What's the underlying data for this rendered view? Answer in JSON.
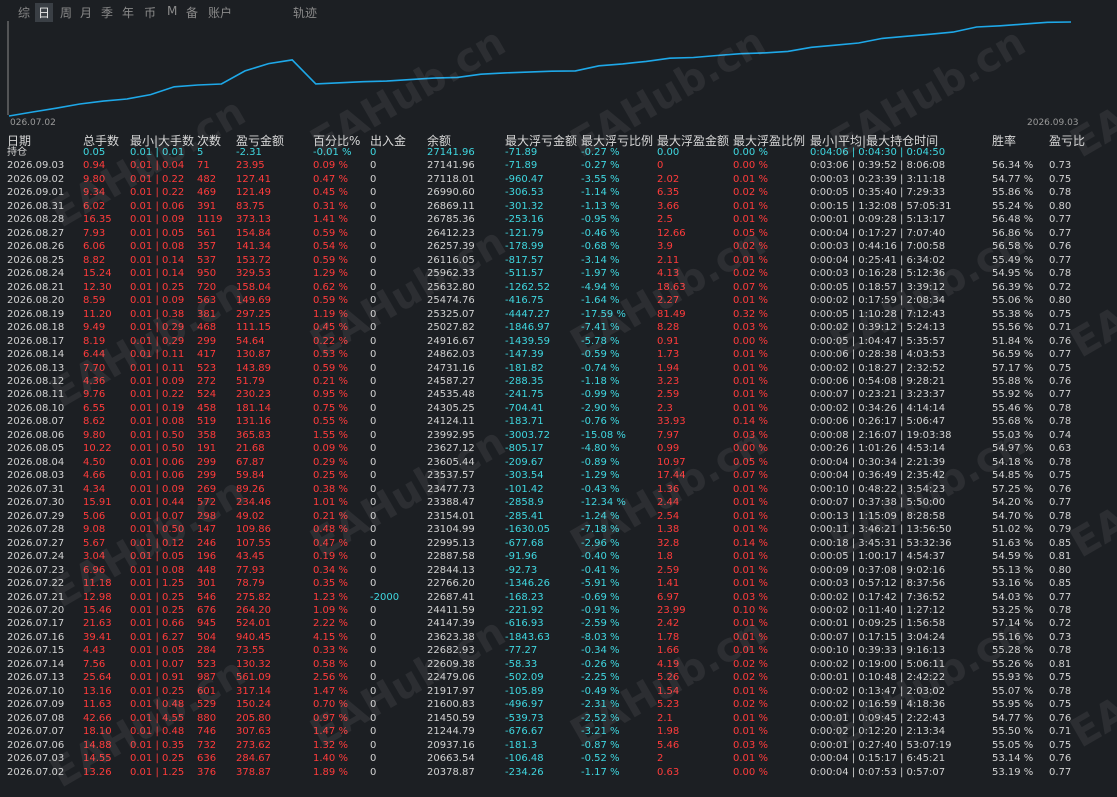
{
  "tabs": [
    "综",
    "日",
    "周",
    "月",
    "季",
    "年",
    "币",
    "M",
    "备",
    "账户",
    "轨迹"
  ],
  "active_tab": 1,
  "chart_data": {
    "type": "line",
    "x_start_label": "026.07.02",
    "x_end_label": "2026.09.03",
    "line_color": "#1ea8e8",
    "y": [
      20378.87,
      20663.54,
      20937.16,
      21244.79,
      21450.59,
      21600.83,
      21917.97,
      22479.06,
      22609.38,
      22682.93,
      23623.38,
      24147.39,
      24411.59,
      22687.41,
      22766.2,
      22844.13,
      22887.58,
      22995.13,
      23104.99,
      23154.01,
      23388.47,
      23477.73,
      23537.57,
      23605.44,
      23627.12,
      23992.95,
      24124.11,
      24305.25,
      24535.48,
      24587.27,
      24731.16,
      24862.03,
      24916.67,
      25027.82,
      25325.07,
      25474.76,
      25632.8,
      25962.33,
      26116.05,
      26257.39,
      26412.23,
      26785.36,
      26869.11,
      26990.6,
      27118.01,
      27141.96
    ]
  },
  "columns": [
    "日期",
    "总手数",
    "最小|大手数",
    "次数",
    "盈亏金额",
    "百分比%",
    "出入金",
    "余额",
    "最大浮亏金额",
    "最大浮亏比例",
    "最大浮盈金额",
    "最大浮盈比例",
    "最小|平均|最大持仓时间",
    "胜率",
    "盈亏比"
  ],
  "holding_row": [
    "持仓",
    "0.05",
    "0.01 | 0.01",
    "5",
    "-2.31",
    "-0.01 %",
    "0",
    "27141.96",
    "-71.89",
    "-0.27 %",
    "0.00",
    "0.00 %",
    "0:04:06 | 0:04:30 | 0:04:50",
    "",
    ""
  ],
  "rows": [
    [
      "2026.09.03",
      "0.94",
      "0.01 | 0.04",
      "71",
      "23.95",
      "0.09 %",
      "0",
      "27141.96",
      "-71.89",
      "-0.27 %",
      "0",
      "0.00 %",
      "0:03:06 | 0:39:52 | 8:06:08",
      "56.34 %",
      "0.73"
    ],
    [
      "2026.09.02",
      "9.80",
      "0.01 | 0.22",
      "482",
      "127.41",
      "0.47 %",
      "0",
      "27118.01",
      "-960.47",
      "-3.55 %",
      "2.02",
      "0.01 %",
      "0:00:03 | 0:23:39 | 3:11:18",
      "54.77 %",
      "0.75"
    ],
    [
      "2026.09.01",
      "9.34",
      "0.01 | 0.22",
      "469",
      "121.49",
      "0.45 %",
      "0",
      "26990.60",
      "-306.53",
      "-1.14 %",
      "6.35",
      "0.02 %",
      "0:00:05 | 0:35:40 | 7:29:33",
      "55.86 %",
      "0.78"
    ],
    [
      "2026.08.31",
      "6.02",
      "0.01 | 0.06",
      "391",
      "83.75",
      "0.31 %",
      "0",
      "26869.11",
      "-301.32",
      "-1.13 %",
      "3.66",
      "0.01 %",
      "0:00:15 | 1:32:08 | 57:05:31",
      "55.24 %",
      "0.80"
    ],
    [
      "2026.08.28",
      "16.35",
      "0.01 | 0.09",
      "1119",
      "373.13",
      "1.41 %",
      "0",
      "26785.36",
      "-253.16",
      "-0.95 %",
      "2.5",
      "0.01 %",
      "0:00:01 | 0:09:28 | 5:13:17",
      "56.48 %",
      "0.77"
    ],
    [
      "2026.08.27",
      "7.93",
      "0.01 | 0.05",
      "561",
      "154.84",
      "0.59 %",
      "0",
      "26412.23",
      "-121.79",
      "-0.46 %",
      "12.66",
      "0.05 %",
      "0:00:04 | 0:17:27 | 7:07:40",
      "56.86 %",
      "0.77"
    ],
    [
      "2026.08.26",
      "6.06",
      "0.01 | 0.08",
      "357",
      "141.34",
      "0.54 %",
      "0",
      "26257.39",
      "-178.99",
      "-0.68 %",
      "3.9",
      "0.02 %",
      "0:00:03 | 0:44:16 | 7:00:58",
      "56.58 %",
      "0.76"
    ],
    [
      "2026.08.25",
      "8.82",
      "0.01 | 0.14",
      "537",
      "153.72",
      "0.59 %",
      "0",
      "26116.05",
      "-817.57",
      "-3.14 %",
      "2.11",
      "0.01 %",
      "0:00:04 | 0:25:41 | 6:34:02",
      "55.49 %",
      "0.77"
    ],
    [
      "2026.08.24",
      "15.24",
      "0.01 | 0.14",
      "950",
      "329.53",
      "1.29 %",
      "0",
      "25962.33",
      "-511.57",
      "-1.97 %",
      "4.13",
      "0.02 %",
      "0:00:03 | 0:16:28 | 5:12:36",
      "54.95 %",
      "0.78"
    ],
    [
      "2026.08.21",
      "12.30",
      "0.01 | 0.25",
      "720",
      "158.04",
      "0.62 %",
      "0",
      "25632.80",
      "-1262.52",
      "-4.94 %",
      "18.63",
      "0.07 %",
      "0:00:05 | 0:18:57 | 3:39:12",
      "56.39 %",
      "0.72"
    ],
    [
      "2026.08.20",
      "8.59",
      "0.01 | 0.09",
      "563",
      "149.69",
      "0.59 %",
      "0",
      "25474.76",
      "-416.75",
      "-1.64 %",
      "2.27",
      "0.01 %",
      "0:00:02 | 0:17:59 | 2:08:34",
      "55.06 %",
      "0.80"
    ],
    [
      "2026.08.19",
      "11.20",
      "0.01 | 0.38",
      "381",
      "297.25",
      "1.19 %",
      "0",
      "25325.07",
      "-4447.27",
      "-17.59 %",
      "81.49",
      "0.32 %",
      "0:00:05 | 1:10:28 | 7:12:43",
      "55.38 %",
      "0.75"
    ],
    [
      "2026.08.18",
      "9.49",
      "0.01 | 0.29",
      "468",
      "111.15",
      "0.45 %",
      "0",
      "25027.82",
      "-1846.97",
      "-7.41 %",
      "8.28",
      "0.03 %",
      "0:00:02 | 0:39:12 | 5:24:13",
      "55.56 %",
      "0.71"
    ],
    [
      "2026.08.17",
      "8.19",
      "0.01 | 0.29",
      "299",
      "54.64",
      "0.22 %",
      "0",
      "24916.67",
      "-1439.59",
      "-5.78 %",
      "0.91",
      "0.00 %",
      "0:00:05 | 1:04:47 | 5:35:57",
      "51.84 %",
      "0.76"
    ],
    [
      "2026.08.14",
      "6.44",
      "0.01 | 0.11",
      "417",
      "130.87",
      "0.53 %",
      "0",
      "24862.03",
      "-147.39",
      "-0.59 %",
      "1.73",
      "0.01 %",
      "0:00:06 | 0:28:38 | 4:03:53",
      "56.59 %",
      "0.77"
    ],
    [
      "2026.08.13",
      "7.70",
      "0.01 | 0.11",
      "523",
      "143.89",
      "0.59 %",
      "0",
      "24731.16",
      "-181.82",
      "-0.74 %",
      "1.94",
      "0.01 %",
      "0:00:02 | 0:18:27 | 2:32:52",
      "57.17 %",
      "0.75"
    ],
    [
      "2026.08.12",
      "4.36",
      "0.01 | 0.09",
      "272",
      "51.79",
      "0.21 %",
      "0",
      "24587.27",
      "-288.35",
      "-1.18 %",
      "3.23",
      "0.01 %",
      "0:00:06 | 0:54:08 | 9:28:21",
      "55.88 %",
      "0.76"
    ],
    [
      "2026.08.11",
      "9.76",
      "0.01 | 0.22",
      "524",
      "230.23",
      "0.95 %",
      "0",
      "24535.48",
      "-241.75",
      "-0.99 %",
      "2.59",
      "0.01 %",
      "0:00:07 | 0:23:21 | 3:23:37",
      "55.92 %",
      "0.77"
    ],
    [
      "2026.08.10",
      "6.55",
      "0.01 | 0.19",
      "458",
      "181.14",
      "0.75 %",
      "0",
      "24305.25",
      "-704.41",
      "-2.90 %",
      "2.3",
      "0.01 %",
      "0:00:02 | 0:34:26 | 4:14:14",
      "55.46 %",
      "0.78"
    ],
    [
      "2026.08.07",
      "8.62",
      "0.01 | 0.08",
      "519",
      "131.16",
      "0.55 %",
      "0",
      "24124.11",
      "-183.71",
      "-0.76 %",
      "33.93",
      "0.14 %",
      "0:00:06 | 0:26:17 | 5:06:47",
      "55.68 %",
      "0.78"
    ],
    [
      "2026.08.06",
      "9.80",
      "0.01 | 0.50",
      "358",
      "365.83",
      "1.55 %",
      "0",
      "23992.95",
      "-3003.72",
      "-15.08 %",
      "7.97",
      "0.03 %",
      "0:00:08 | 2:16:07 | 19:03:38",
      "55.03 %",
      "0.74"
    ],
    [
      "2026.08.05",
      "10.22",
      "0.01 | 0.50",
      "191",
      "21.68",
      "0.09 %",
      "0",
      "23627.12",
      "-805.17",
      "-4.80 %",
      "0.99",
      "0.00 %",
      "0:00:26 | 1:01:26 | 4:53:14",
      "54.97 %",
      "0.63"
    ],
    [
      "2026.08.04",
      "4.50",
      "0.01 | 0.06",
      "299",
      "67.87",
      "0.29 %",
      "0",
      "23605.44",
      "-209.67",
      "-0.89 %",
      "10.97",
      "0.05 %",
      "0:00:04 | 0:30:34 | 2:21:39",
      "54.18 %",
      "0.78"
    ],
    [
      "2026.08.03",
      "4.66",
      "0.01 | 0.06",
      "299",
      "59.84",
      "0.25 %",
      "0",
      "23537.57",
      "-303.54",
      "-1.29 %",
      "17.44",
      "0.07 %",
      "0:00:04 | 0:36:49 | 2:35:42",
      "54.85 %",
      "0.75"
    ],
    [
      "2026.07.31",
      "4.34",
      "0.01 | 0.09",
      "269",
      "89.26",
      "0.38 %",
      "0",
      "23477.73",
      "-101.42",
      "-0.43 %",
      "1.36",
      "0.01 %",
      "0:00:10 | 0:48:22 | 3:54:23",
      "57.25 %",
      "0.76"
    ],
    [
      "2026.07.30",
      "15.91",
      "0.01 | 0.44",
      "572",
      "234.46",
      "1.01 %",
      "0",
      "23388.47",
      "-2858.9",
      "-12.34 %",
      "2.44",
      "0.01 %",
      "0:00:07 | 0:37:38 | 5:50:00",
      "54.20 %",
      "0.77"
    ],
    [
      "2026.07.29",
      "5.06",
      "0.01 | 0.07",
      "298",
      "49.02",
      "0.21 %",
      "0",
      "23154.01",
      "-285.41",
      "-1.24 %",
      "2.54",
      "0.01 %",
      "0:00:13 | 1:15:09 | 8:28:58",
      "54.70 %",
      "0.78"
    ],
    [
      "2026.07.28",
      "9.08",
      "0.01 | 0.50",
      "147",
      "109.86",
      "0.48 %",
      "0",
      "23104.99",
      "-1630.05",
      "-7.18 %",
      "1.38",
      "0.01 %",
      "0:00:11 | 3:46:21 | 13:56:50",
      "51.02 %",
      "0.79"
    ],
    [
      "2026.07.27",
      "5.67",
      "0.01 | 0.12",
      "246",
      "107.55",
      "0.47 %",
      "0",
      "22995.13",
      "-677.68",
      "-2.96 %",
      "32.8",
      "0.14 %",
      "0:00:18 | 3:45:31 | 53:32:36",
      "51.63 %",
      "0.85"
    ],
    [
      "2026.07.24",
      "3.04",
      "0.01 | 0.05",
      "196",
      "43.45",
      "0.19 %",
      "0",
      "22887.58",
      "-91.96",
      "-0.40 %",
      "1.8",
      "0.01 %",
      "0:00:05 | 1:00:17 | 4:54:37",
      "54.59 %",
      "0.81"
    ],
    [
      "2026.07.23",
      "6.96",
      "0.01 | 0.08",
      "448",
      "77.93",
      "0.34 %",
      "0",
      "22844.13",
      "-92.73",
      "-0.41 %",
      "2.59",
      "0.01 %",
      "0:00:09 | 0:37:08 | 9:02:16",
      "55.13 %",
      "0.80"
    ],
    [
      "2026.07.22",
      "11.18",
      "0.01 | 1.25",
      "301",
      "78.79",
      "0.35 %",
      "0",
      "22766.20",
      "-1346.26",
      "-5.91 %",
      "1.41",
      "0.01 %",
      "0:00:03 | 0:57:12 | 8:37:56",
      "53.16 %",
      "0.85"
    ],
    [
      "2026.07.21",
      "12.98",
      "0.01 | 0.25",
      "546",
      "275.82",
      "1.23 %",
      "-2000",
      "22687.41",
      "-168.23",
      "-0.69 %",
      "6.97",
      "0.03 %",
      "0:00:02 | 0:17:42 | 7:36:52",
      "54.03 %",
      "0.77"
    ],
    [
      "2026.07.20",
      "15.46",
      "0.01 | 0.25",
      "676",
      "264.20",
      "1.09 %",
      "0",
      "24411.59",
      "-221.92",
      "-0.91 %",
      "23.99",
      "0.10 %",
      "0:00:02 | 0:11:40 | 1:27:12",
      "53.25 %",
      "0.78"
    ],
    [
      "2026.07.17",
      "21.63",
      "0.01 | 0.66",
      "945",
      "524.01",
      "2.22 %",
      "0",
      "24147.39",
      "-616.93",
      "-2.59 %",
      "2.42",
      "0.01 %",
      "0:00:01 | 0:09:25 | 1:56:58",
      "57.14 %",
      "0.72"
    ],
    [
      "2026.07.16",
      "39.41",
      "0.01 | 6.27",
      "504",
      "940.45",
      "4.15 %",
      "0",
      "23623.38",
      "-1843.63",
      "-8.03 %",
      "1.78",
      "0.01 %",
      "0:00:07 | 0:17:15 | 3:04:24",
      "55.16 %",
      "0.73"
    ],
    [
      "2026.07.15",
      "4.43",
      "0.01 | 0.05",
      "284",
      "73.55",
      "0.33 %",
      "0",
      "22682.93",
      "-77.27",
      "-0.34 %",
      "1.66",
      "0.01 %",
      "0:00:10 | 0:39:33 | 9:16:13",
      "55.28 %",
      "0.78"
    ],
    [
      "2026.07.14",
      "7.56",
      "0.01 | 0.07",
      "523",
      "130.32",
      "0.58 %",
      "0",
      "22609.38",
      "-58.33",
      "-0.26 %",
      "4.19",
      "0.02 %",
      "0:00:02 | 0:19:00 | 5:06:11",
      "55.26 %",
      "0.81"
    ],
    [
      "2026.07.13",
      "25.64",
      "0.01 | 0.91",
      "987",
      "561.09",
      "2.56 %",
      "0",
      "22479.06",
      "-502.09",
      "-2.25 %",
      "5.26",
      "0.02 %",
      "0:00:01 | 0:10:48 | 2:42:22",
      "55.93 %",
      "0.75"
    ],
    [
      "2026.07.10",
      "13.16",
      "0.01 | 0.25",
      "601",
      "317.14",
      "1.47 %",
      "0",
      "21917.97",
      "-105.89",
      "-0.49 %",
      "1.54",
      "0.01 %",
      "0:00:02 | 0:13:47 | 2:03:02",
      "55.07 %",
      "0.78"
    ],
    [
      "2026.07.09",
      "11.63",
      "0.01 | 0.48",
      "529",
      "150.24",
      "0.70 %",
      "0",
      "21600.83",
      "-496.97",
      "-2.31 %",
      "5.23",
      "0.02 %",
      "0:00:02 | 0:16:59 | 4:18:36",
      "55.95 %",
      "0.75"
    ],
    [
      "2026.07.08",
      "42.66",
      "0.01 | 4.55",
      "880",
      "205.80",
      "0.97 %",
      "0",
      "21450.59",
      "-539.73",
      "-2.52 %",
      "2.1",
      "0.01 %",
      "0:00:01 | 0:09:45 | 2:22:43",
      "54.77 %",
      "0.76"
    ],
    [
      "2026.07.07",
      "18.10",
      "0.01 | 0.48",
      "746",
      "307.63",
      "1.47 %",
      "0",
      "21244.79",
      "-676.67",
      "-3.21 %",
      "1.98",
      "0.01 %",
      "0:00:02 | 0:12:20 | 2:13:34",
      "55.50 %",
      "0.71"
    ],
    [
      "2026.07.06",
      "14.88",
      "0.01 | 0.35",
      "732",
      "273.62",
      "1.32 %",
      "0",
      "20937.16",
      "-181.3",
      "-0.87 %",
      "5.46",
      "0.03 %",
      "0:00:01 | 0:27:40 | 53:07:19",
      "55.05 %",
      "0.75"
    ],
    [
      "2026.07.03",
      "14.55",
      "0.01 | 0.25",
      "636",
      "284.67",
      "1.40 %",
      "0",
      "20663.54",
      "-106.48",
      "-0.52 %",
      "2",
      "0.01 %",
      "0:00:04 | 0:15:17 | 6:45:21",
      "53.14 %",
      "0.76"
    ],
    [
      "2026.07.02",
      "13.26",
      "0.01 | 1.25",
      "376",
      "378.87",
      "1.89 %",
      "0",
      "20378.87",
      "-234.26",
      "-1.17 %",
      "0.63",
      "0.00 %",
      "0:00:04 | 0:07:53 | 0:57:07",
      "53.19 %",
      "0.77"
    ]
  ],
  "watermark": "EAHub.cn",
  "colors": {
    "bg": "#1c1f23",
    "cyan": "#3fd7e0",
    "red": "#ff3b3b",
    "white": "#d2d2d2",
    "line": "#1ea8e8"
  }
}
